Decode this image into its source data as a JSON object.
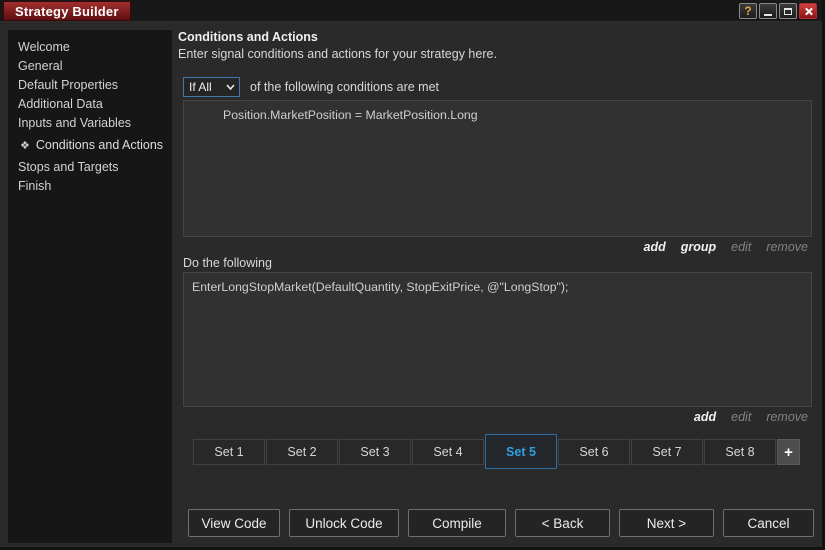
{
  "window": {
    "title": "Strategy Builder",
    "controls": {
      "help": "?",
      "minimize": "minimize",
      "maximize": "maximize",
      "close": "close"
    }
  },
  "sidebar": {
    "items": [
      {
        "label": "Welcome"
      },
      {
        "label": "General"
      },
      {
        "label": "Default Properties"
      },
      {
        "label": "Additional Data"
      },
      {
        "label": "Inputs and Variables"
      },
      {
        "label": "Conditions and Actions",
        "icon": "❖",
        "active": true
      },
      {
        "label": "Stops and Targets"
      },
      {
        "label": "Finish"
      }
    ]
  },
  "main": {
    "title": "Conditions and Actions",
    "subtitle": "Enter signal conditions and actions for your strategy here.",
    "conditions": {
      "operator_value": "If All",
      "operator_suffix": "of the following conditions are met",
      "items": [
        "Position.MarketPosition = MarketPosition.Long"
      ],
      "links": [
        {
          "label": "add",
          "enabled": true
        },
        {
          "label": "group",
          "enabled": true
        },
        {
          "label": "edit",
          "enabled": false
        },
        {
          "label": "remove",
          "enabled": false
        }
      ]
    },
    "actions": {
      "label": "Do the following",
      "items": [
        "EnterLongStopMarket(DefaultQuantity, StopExitPrice, @\"LongStop\");"
      ],
      "links": [
        {
          "label": "add",
          "enabled": true
        },
        {
          "label": "edit",
          "enabled": false
        },
        {
          "label": "remove",
          "enabled": false
        }
      ]
    },
    "tabs": {
      "items": [
        "Set 1",
        "Set 2",
        "Set 3",
        "Set 4",
        "Set 5",
        "Set 6",
        "Set 7",
        "Set 8"
      ],
      "selected": "Set 5",
      "add_button": "+"
    },
    "buttons": [
      {
        "label": "View Code"
      },
      {
        "label": "Unlock Code"
      },
      {
        "label": "Compile"
      },
      {
        "label": "< Back"
      },
      {
        "label": "Next >"
      },
      {
        "label": "Cancel"
      }
    ]
  },
  "colors": {
    "accent_blue": "#2f9fe0",
    "accent_blue_border": "#2d6da3",
    "titlebar_red_top": "#a22f2f",
    "titlebar_red_bottom": "#5e0f0f",
    "close_red": "#8c1414",
    "help_orange": "#e8a33d",
    "window_bg": "#2a2a2a",
    "sidebar_bg": "#161616",
    "box_bg": "#313131"
  }
}
